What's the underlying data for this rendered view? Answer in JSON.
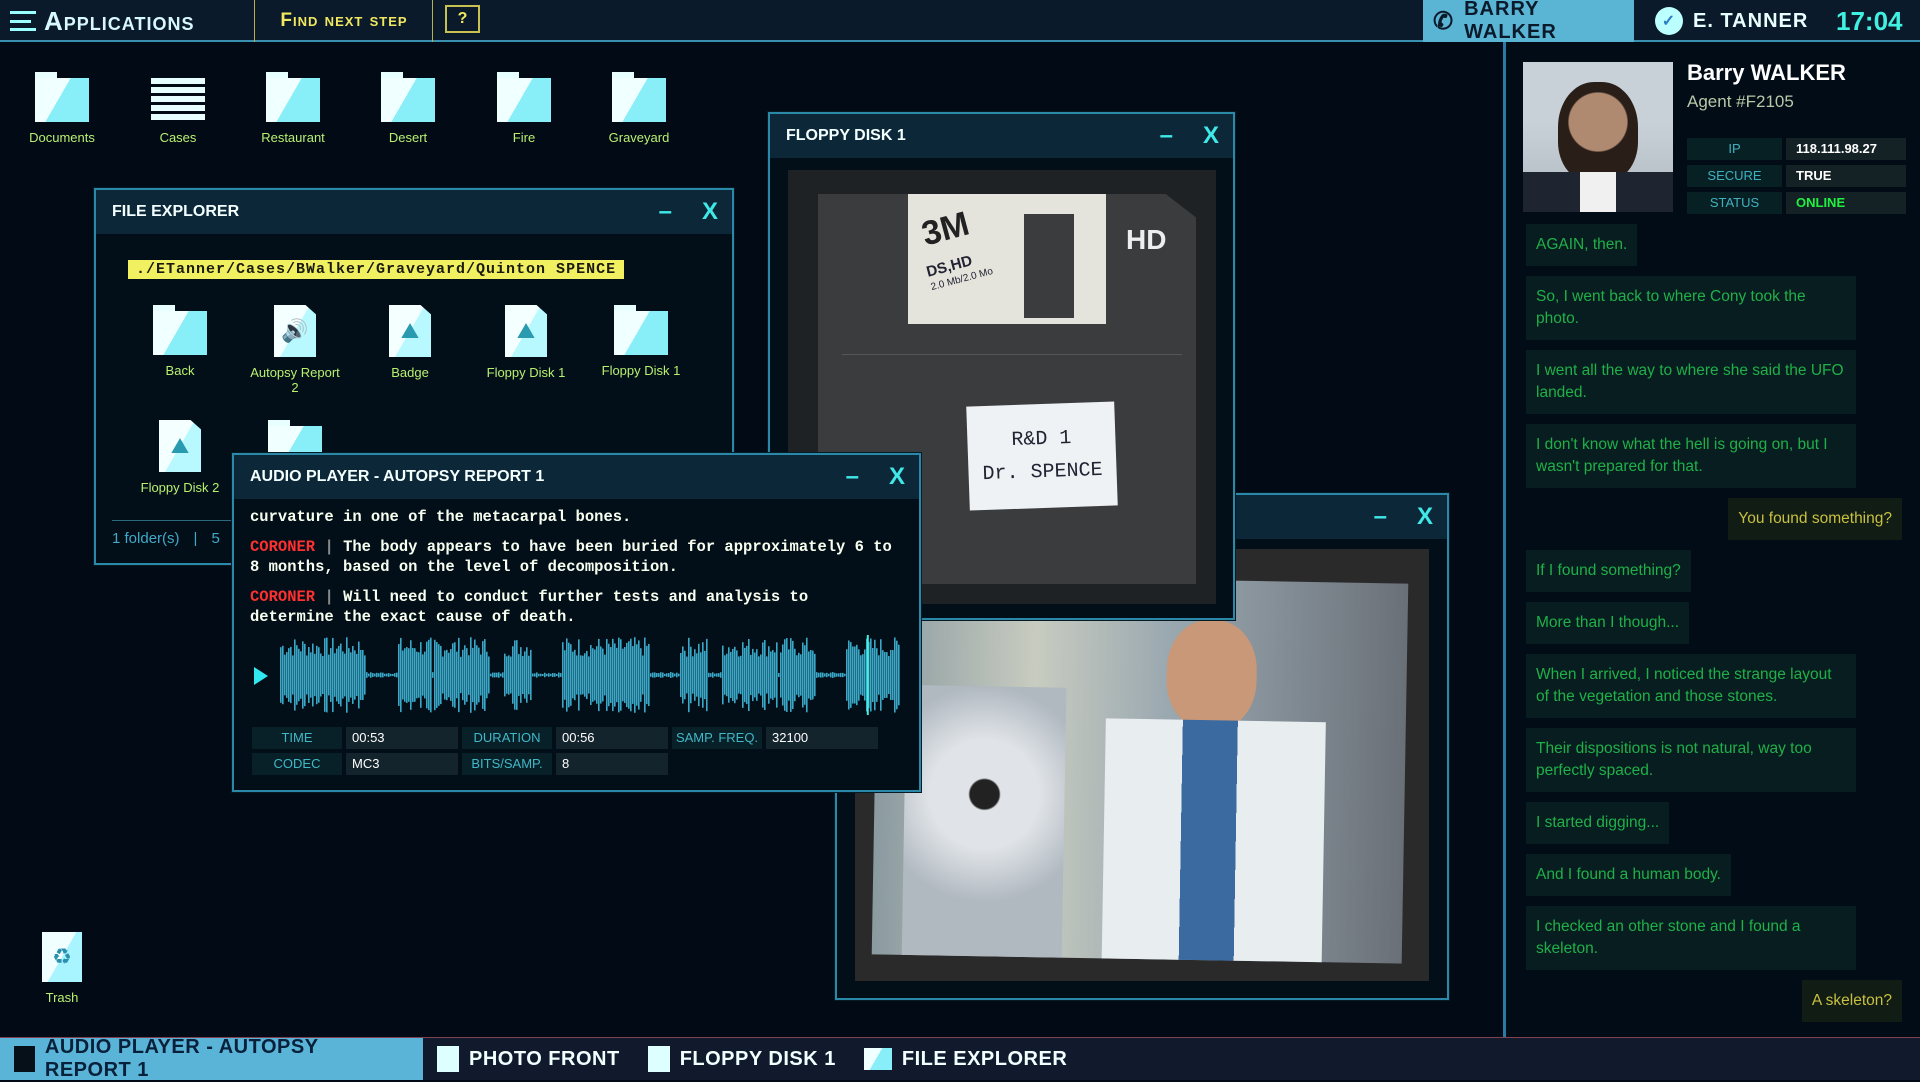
{
  "topbar": {
    "apps_label": "Applications",
    "find_next_step": "Find next step",
    "help": "?",
    "call_name": "BARRY WALKER",
    "user_name": "E. TANNER",
    "clock": "17:04"
  },
  "desktop": {
    "icons": [
      {
        "label": "Documents"
      },
      {
        "label": "Cases"
      },
      {
        "label": "Restaurant"
      },
      {
        "label": "Desert"
      },
      {
        "label": "Fire"
      },
      {
        "label": "Graveyard"
      }
    ],
    "trash": "Trash"
  },
  "file_explorer": {
    "title": "FILE EXPLORER",
    "path": "./ETanner/Cases/BWalker/Graveyard/Quinton SPENCE",
    "items": [
      {
        "label": "Back",
        "type": "back"
      },
      {
        "label": "Autopsy Report 2",
        "type": "audio"
      },
      {
        "label": "Badge",
        "type": "image"
      },
      {
        "label": "Floppy Disk 1",
        "type": "image"
      },
      {
        "label": "Floppy Disk 1",
        "type": "folder"
      },
      {
        "label": "Floppy Disk 2",
        "type": "image"
      }
    ],
    "footer_folders": "1 folder(s)",
    "footer_sep": "|",
    "footer_files": "5"
  },
  "audio_player": {
    "title": "AUDIO PLAYER - AUTOPSY REPORT 1",
    "lines": [
      {
        "speaker": "",
        "text": "curvature in one of the metacarpal bones."
      },
      {
        "speaker": "CORONER",
        "text": "The body appears to have been buried for approximately 6 to 8 months, based on the level of decomposition."
      },
      {
        "speaker": "CORONER",
        "text": "Will need to conduct further tests and analysis to determine the exact cause of death."
      }
    ],
    "time_label": "TIME",
    "time": "00:53",
    "duration_label": "DURATION",
    "duration": "00:56",
    "freq_label": "SAMP. FREQ.",
    "freq": "32100",
    "codec_label": "CODEC",
    "codec": "MC3",
    "bits_label": "BITS/SAMP.",
    "bits": "8",
    "colors": {
      "wave": "#3aa8c8",
      "playhead": "#40f0e0"
    }
  },
  "floppy_window": {
    "title": "FLOPPY DISK 1",
    "brand": "3M",
    "type": "DS,HD",
    "capacity": "2.0 Mb/2.0 Mo",
    "hd": "HD",
    "label_line1": "R&D 1",
    "label_line2": "Dr. SPENCE"
  },
  "photo_window": {
    "title": ""
  },
  "contact": {
    "name": "Barry WALKER",
    "agent": "Agent #F2105",
    "ip_label": "IP",
    "ip": "118.111.98.27",
    "secure_label": "SECURE",
    "secure": "TRUE",
    "status_label": "STATUS",
    "status": "ONLINE",
    "status_color": "#20f040"
  },
  "chat": [
    {
      "from": "them",
      "text": "AGAIN, then."
    },
    {
      "from": "them",
      "text": "So, I went back to where Cony took the photo."
    },
    {
      "from": "them",
      "text": "I went all the way to where she said the UFO landed."
    },
    {
      "from": "them",
      "text": "I don't know what the hell is going on, but I wasn't prepared for that."
    },
    {
      "from": "me",
      "text": "You found something?"
    },
    {
      "from": "them",
      "text": "If I found something?"
    },
    {
      "from": "them",
      "text": "More than I though..."
    },
    {
      "from": "them",
      "text": "When I arrived, I noticed the strange layout of the vegetation and those stones."
    },
    {
      "from": "them",
      "text": "Their dispositions is not natural, way too perfectly spaced."
    },
    {
      "from": "them",
      "text": "I started digging..."
    },
    {
      "from": "them",
      "text": "And I found a human body."
    },
    {
      "from": "them",
      "text": "I checked an other stone and I found a skeleton."
    },
    {
      "from": "me",
      "text": "A skeleton?"
    }
  ],
  "taskbar": [
    {
      "label": "AUDIO PLAYER - AUTOPSY REPORT 1",
      "active": true
    },
    {
      "label": "PHOTO FRONT"
    },
    {
      "label": "FLOPPY DISK 1"
    },
    {
      "label": "FILE EXPLORER"
    }
  ]
}
